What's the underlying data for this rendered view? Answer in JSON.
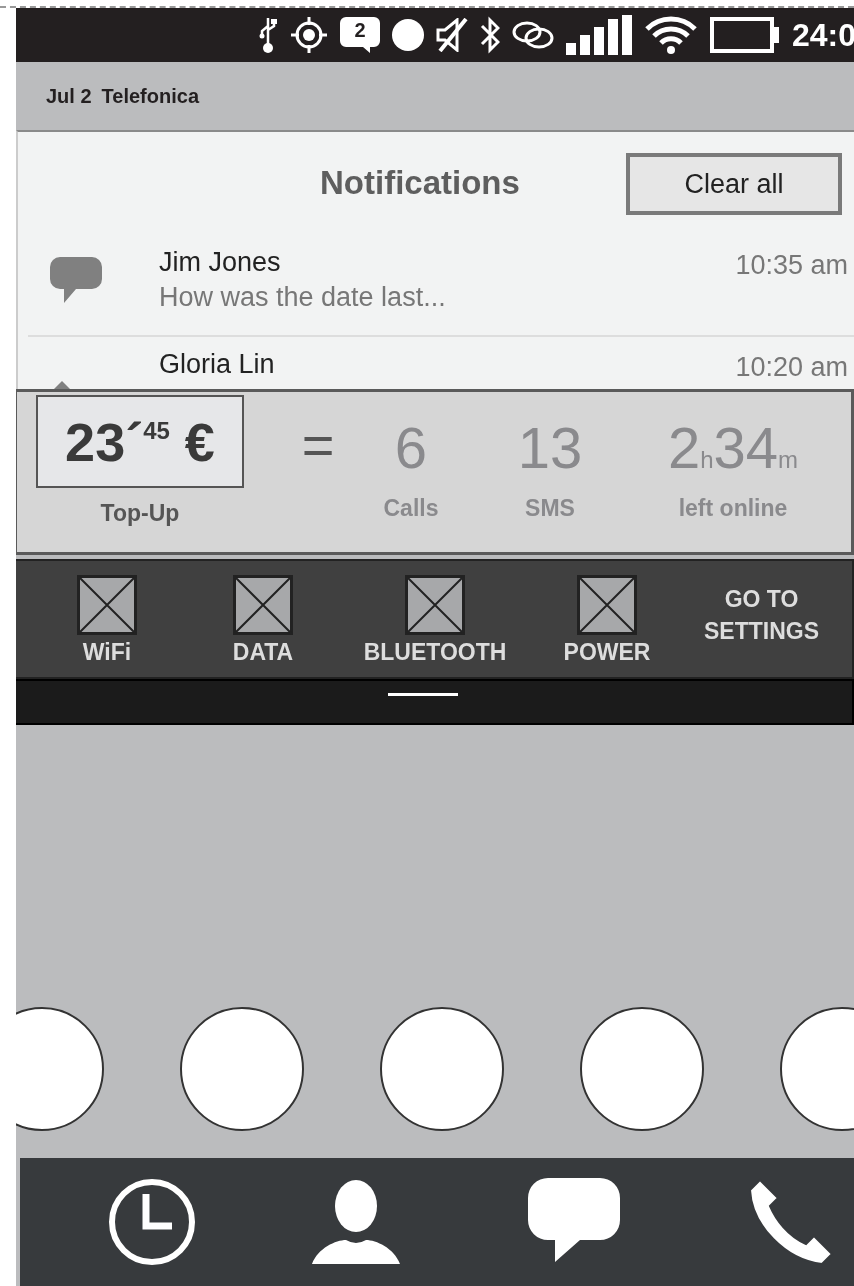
{
  "status_bar": {
    "message_count": "2",
    "time": "24:0"
  },
  "carrier_line": {
    "date": "Jul 2",
    "carrier": "Telefonica"
  },
  "notifications": {
    "title": "Notifications",
    "clear_button": "Clear all",
    "items": [
      {
        "kind": "message",
        "name": "Jim Jones",
        "preview": "How was the date last...",
        "time": "10:35 am"
      },
      {
        "kind": "edit",
        "name": "Gloria Lin",
        "time": "10:20 am"
      }
    ]
  },
  "balance": {
    "amount": "23´$^{45}$ €",
    "amount_label": "Top-Up",
    "equals": "=",
    "stats": [
      {
        "value": "6",
        "label": "Calls"
      },
      {
        "value": "13",
        "label": "SMS"
      },
      {
        "value": "2$_{h}$34$_{m}$",
        "label": "left online"
      }
    ]
  },
  "quick_settings": {
    "toggles": [
      {
        "label": "WiFi"
      },
      {
        "label": "DATA"
      },
      {
        "label": "BLUETOOTH"
      },
      {
        "label": "POWER"
      }
    ],
    "settings_link": "GO TO SETTINGS"
  },
  "dock": {
    "apps": [
      {
        "kind": "clock"
      },
      {
        "kind": "contacts"
      },
      {
        "kind": "messages"
      },
      {
        "kind": "phone"
      }
    ]
  }
}
